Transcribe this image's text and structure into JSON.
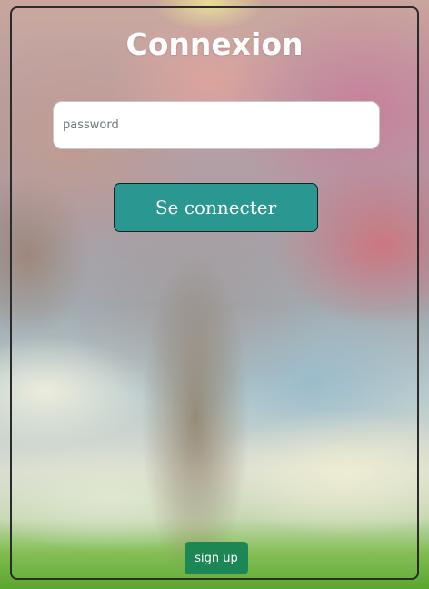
{
  "page": {
    "title": "Connexion"
  },
  "login_form": {
    "password_placeholder": "password",
    "password_value": "",
    "submit_label": "Se connecter"
  },
  "footer": {
    "signup_label": "sign up"
  },
  "colors": {
    "submit_button": "#2a9790",
    "signup_button": "#1c8754",
    "title_text": "#ffffff"
  }
}
